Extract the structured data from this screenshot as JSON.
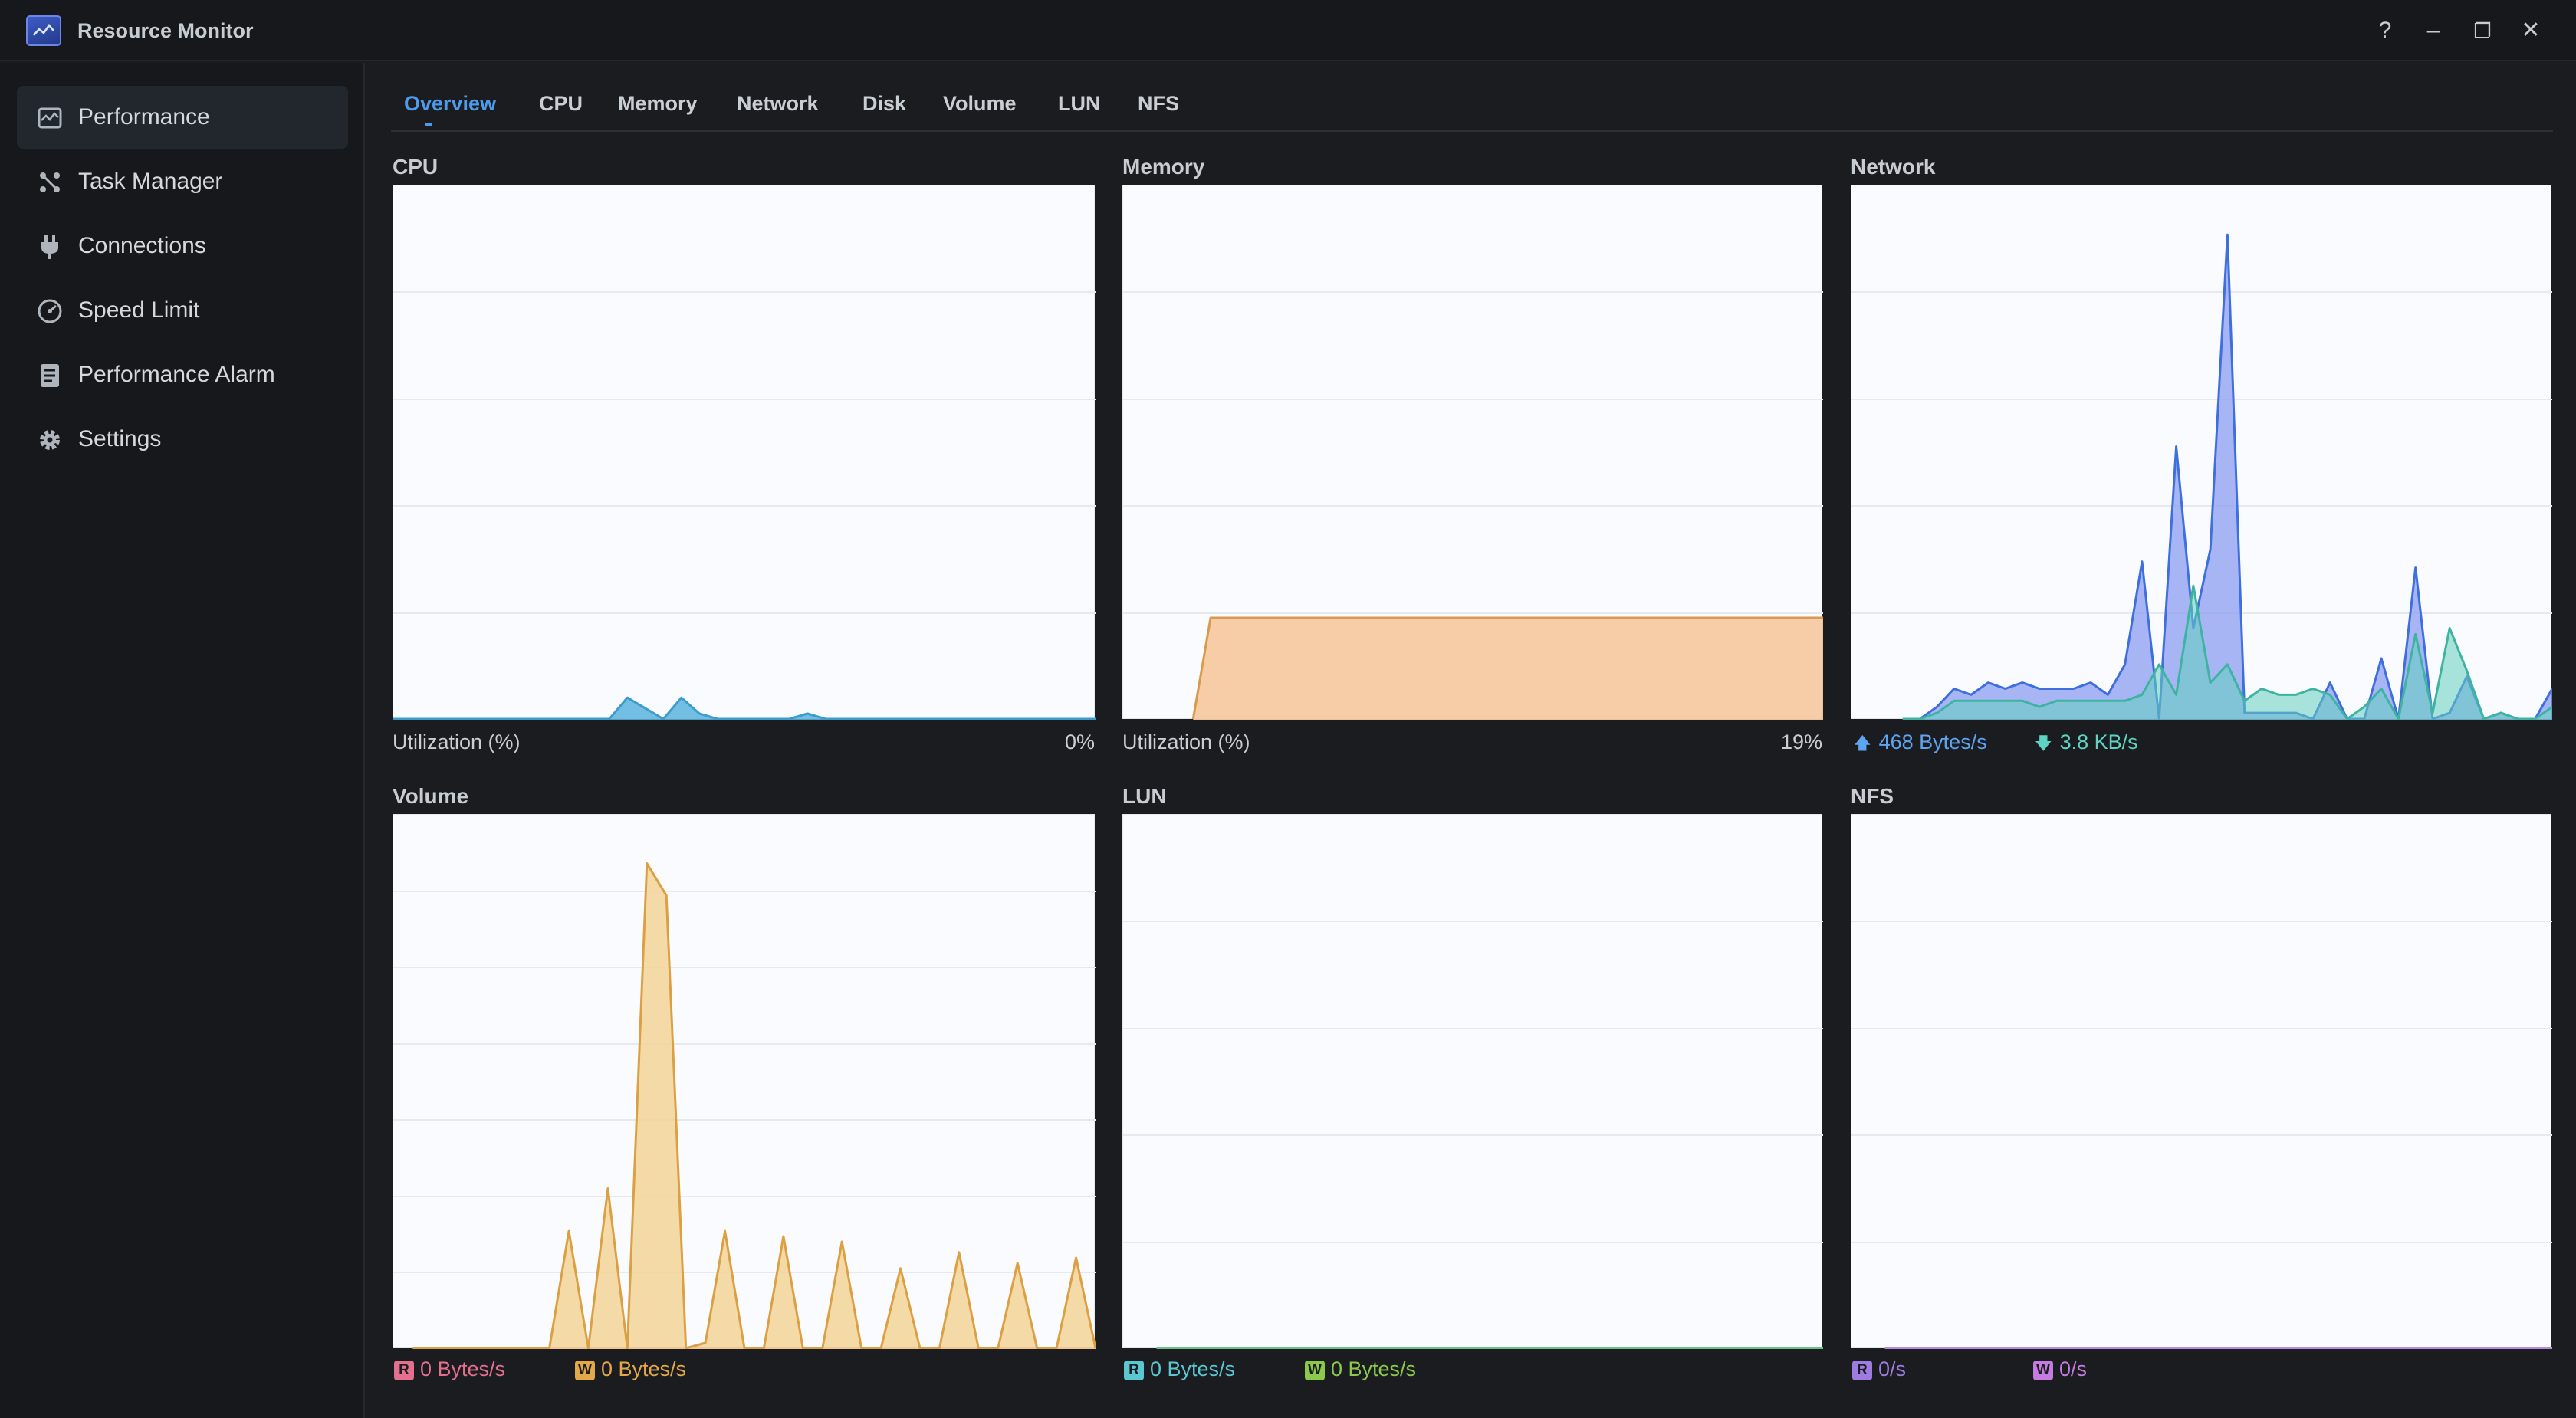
{
  "app": {
    "title": "Resource Monitor"
  },
  "window_controls": {
    "help": "?",
    "minimize": "–",
    "restore": "❐",
    "close": "✕"
  },
  "sidebar": {
    "items": [
      {
        "label": "Performance",
        "icon": "performance-icon",
        "active": true
      },
      {
        "label": "Task Manager",
        "icon": "task-manager-icon",
        "active": false
      },
      {
        "label": "Connections",
        "icon": "plug-icon",
        "active": false
      },
      {
        "label": "Speed Limit",
        "icon": "speedometer-icon",
        "active": false
      },
      {
        "label": "Performance Alarm",
        "icon": "alarm-list-icon",
        "active": false
      },
      {
        "label": "Settings",
        "icon": "gear-icon",
        "active": false
      }
    ]
  },
  "tabs": [
    {
      "label": "Overview",
      "active": true
    },
    {
      "label": "CPU"
    },
    {
      "label": "Memory"
    },
    {
      "label": "Network"
    },
    {
      "label": "Disk"
    },
    {
      "label": "Volume"
    },
    {
      "label": "LUN"
    },
    {
      "label": "NFS"
    }
  ],
  "panels": {
    "cpu": {
      "title": "CPU",
      "label": "Utilization  (%)",
      "value": "0%"
    },
    "memory": {
      "title": "Memory",
      "label": "Utilization  (%)",
      "value": "19%"
    },
    "network": {
      "title": "Network",
      "upload": "468 Bytes/s",
      "download": "3.8 KB/s"
    },
    "volume": {
      "title": "Volume",
      "read_badge": "R",
      "read": "0 Bytes/s",
      "write_badge": "W",
      "write": "0 Bytes/s"
    },
    "lun": {
      "title": "LUN",
      "read_badge": "R",
      "read": "0 Bytes/s",
      "write_badge": "W",
      "write": "0 Bytes/s"
    },
    "nfs": {
      "title": "NFS",
      "read_badge": "R",
      "read": "0/s",
      "write_badge": "W",
      "write": "0/s"
    }
  },
  "colors": {
    "accent": "#4d9bea",
    "cpu": "#4aa7d4",
    "memory": "#e79c5b",
    "network_up": "#3f72e0",
    "network_down": "#4fc5b0",
    "volume_read": "#e56f8f",
    "volume_write": "#e2a84a",
    "lun_read": "#5ac8d2",
    "lun_write": "#8cc84b",
    "nfs_read": "#9d7be0",
    "nfs_write": "#c57ce0"
  },
  "chart_data": [
    {
      "name": "CPU",
      "type": "area",
      "ylim": [
        0,
        100
      ],
      "grid": true,
      "values": [
        0,
        0,
        0,
        0,
        0,
        0,
        0,
        0,
        0,
        0,
        0,
        0,
        0,
        4,
        2,
        0,
        4,
        1,
        0,
        0,
        0,
        0,
        0,
        1,
        0,
        0,
        0,
        0,
        0,
        0,
        0,
        0,
        0,
        0,
        0,
        0,
        0,
        0,
        0,
        0
      ]
    },
    {
      "name": "Memory",
      "type": "area",
      "ylim": [
        0,
        100
      ],
      "grid": true,
      "values": [
        null,
        null,
        null,
        null,
        0,
        19,
        19,
        19,
        19,
        19,
        19,
        19,
        19,
        19,
        19,
        19,
        19,
        19,
        19,
        19,
        19,
        19,
        19,
        19,
        19,
        19,
        19,
        19,
        19,
        19,
        19,
        19,
        19,
        19,
        19,
        19,
        19,
        19,
        19,
        19,
        19
      ]
    },
    {
      "name": "Network",
      "type": "area",
      "grid": true,
      "series": [
        {
          "name": "upload",
          "values": [
            null,
            null,
            null,
            0,
            0,
            2,
            5,
            4,
            6,
            5,
            6,
            5,
            5,
            5,
            6,
            4,
            9,
            26,
            0,
            45,
            15,
            28,
            80,
            1,
            1,
            1,
            1,
            0,
            6,
            0,
            0,
            10,
            0,
            25,
            0,
            1,
            7,
            0,
            1,
            0,
            0,
            5
          ]
        },
        {
          "name": "download",
          "values": [
            null,
            null,
            null,
            0,
            0,
            1,
            3,
            3,
            3,
            3,
            3,
            2,
            3,
            3,
            3,
            3,
            3,
            4,
            9,
            4,
            22,
            6,
            9,
            3,
            5,
            4,
            4,
            5,
            4,
            0,
            2,
            5,
            0,
            14,
            1,
            15,
            8,
            0,
            1,
            0,
            0,
            2
          ]
        }
      ]
    },
    {
      "name": "Volume",
      "type": "area",
      "grid": true,
      "series": [
        {
          "name": "read",
          "values": [
            null,
            0,
            0,
            0,
            0,
            0,
            0,
            0,
            0,
            0,
            0,
            0,
            0,
            0,
            0,
            0,
            0,
            0,
            0,
            0,
            0,
            0,
            0,
            0,
            0,
            0,
            0,
            0,
            0,
            0,
            0,
            0,
            0,
            0,
            0,
            0
          ]
        },
        {
          "name": "write",
          "values": [
            null,
            0,
            0,
            0,
            0,
            0,
            0,
            0,
            0,
            22,
            0,
            30,
            0,
            91,
            85,
            0,
            1,
            22,
            0,
            0,
            21,
            0,
            0,
            20,
            0,
            0,
            15,
            0,
            0,
            18,
            0,
            0,
            16,
            0,
            0,
            17,
            0
          ]
        }
      ]
    },
    {
      "name": "LUN",
      "type": "area",
      "grid": true,
      "series": [
        {
          "name": "read",
          "values": [
            null,
            0,
            0,
            0,
            0,
            0,
            0,
            0,
            0,
            0,
            0,
            0,
            0,
            0,
            0,
            0,
            0,
            0,
            0,
            0,
            0,
            0
          ]
        },
        {
          "name": "write",
          "values": [
            null,
            0,
            0,
            0,
            0,
            0,
            0,
            0,
            0,
            0,
            0,
            0,
            0,
            0,
            0,
            0,
            0,
            0,
            0,
            0,
            0,
            0
          ]
        }
      ]
    },
    {
      "name": "NFS",
      "type": "area",
      "grid": true,
      "series": [
        {
          "name": "read",
          "values": [
            null,
            0,
            0,
            0,
            0,
            0,
            0,
            0,
            0,
            0,
            0,
            0,
            0,
            0,
            0,
            0,
            0,
            0,
            0,
            0,
            0,
            0
          ]
        },
        {
          "name": "write",
          "values": [
            null,
            0,
            0,
            0,
            0,
            0,
            0,
            0,
            0,
            0,
            0,
            0,
            0,
            0,
            0,
            0,
            0,
            0,
            0,
            0,
            0,
            0
          ]
        }
      ]
    }
  ]
}
